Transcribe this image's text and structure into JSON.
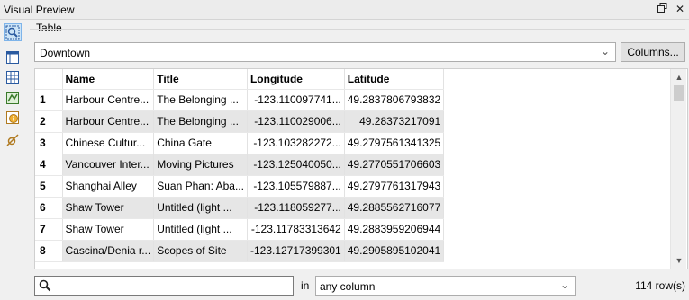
{
  "window": {
    "title": "Visual Preview",
    "float_icon": "float-window-icon",
    "close_icon": "close-icon"
  },
  "toolbar": {
    "tools": [
      "inspect-icon",
      "table-view-icon",
      "grid-icon",
      "map-icon",
      "info-icon",
      "settings-icon"
    ]
  },
  "table_section": {
    "label": "Table",
    "selected_table": "Downtown",
    "columns_button": "Columns..."
  },
  "grid": {
    "headers": [
      "Name",
      "Title",
      "Longitude",
      "Latitude"
    ],
    "rows": [
      {
        "n": "1",
        "cells": [
          "Harbour Centre...",
          "The Belonging ...",
          "-123.110097741...",
          "49.2837806793832"
        ]
      },
      {
        "n": "2",
        "cells": [
          "Harbour Centre...",
          "The Belonging ...",
          "-123.110029006...",
          "49.28373217091"
        ]
      },
      {
        "n": "3",
        "cells": [
          "Chinese Cultur...",
          "China Gate",
          "-123.103282272...",
          "49.2797561341325"
        ]
      },
      {
        "n": "4",
        "cells": [
          "Vancouver Inter...",
          "Moving Pictures",
          "-123.125040050...",
          "49.2770551706603"
        ]
      },
      {
        "n": "5",
        "cells": [
          "Shanghai Alley",
          "Suan Phan: Aba...",
          "-123.105579887...",
          "49.2797761317943"
        ]
      },
      {
        "n": "6",
        "cells": [
          "Shaw Tower",
          "Untitled (light ...",
          "-123.118059277...",
          "49.2885562716077"
        ]
      },
      {
        "n": "7",
        "cells": [
          "Shaw Tower",
          "Untitled (light ...",
          "-123.11783313642",
          "49.2883959206944"
        ]
      },
      {
        "n": "8",
        "cells": [
          "Cascina/Denia r...",
          "Scopes of Site",
          "-123.12717399301",
          "49.2905895102041"
        ]
      }
    ]
  },
  "search": {
    "placeholder": "",
    "in_label": "in",
    "column_filter": "any column",
    "row_count": "114 row(s)"
  }
}
